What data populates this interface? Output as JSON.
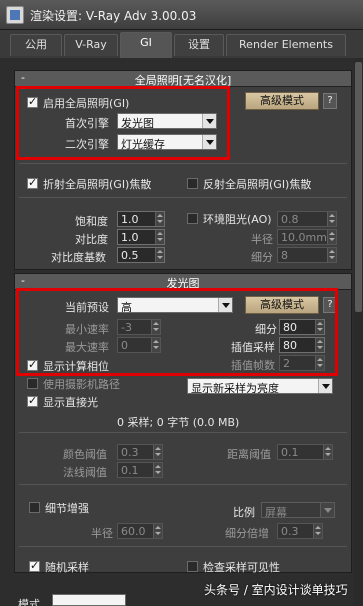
{
  "window": {
    "title": "渲染设置: V-Ray Adv 3.00.03"
  },
  "tabs": [
    {
      "label": "公用"
    },
    {
      "label": "V-Ray"
    },
    {
      "label": "GI"
    },
    {
      "label": "设置"
    },
    {
      "label": "Render Elements"
    }
  ],
  "gi": {
    "rollout_title": "全局照明[无名汉化]",
    "enable_label": "启用全局照明(GI)",
    "advanced_label": "高级模式",
    "help_label": "?",
    "primary_label": "首次引擎",
    "primary_value": "发光图",
    "secondary_label": "二次引擎",
    "secondary_value": "灯光缓存",
    "refractive_label": "折射全局照明(GI)焦散",
    "reflective_label": "反射全局照明(GI)焦散",
    "saturation_label": "饱和度",
    "saturation_value": "1.0",
    "contrast_label": "对比度",
    "contrast_value": "1.0",
    "contrast_base_label": "对比度基数",
    "contrast_base_value": "0.5",
    "ao_label": "环境阻光(AO)",
    "ao_value": "0.8",
    "radius_label": "半径",
    "radius_value": "10.0mm",
    "subdivs_label": "细分",
    "subdivs_value": "8"
  },
  "irradiance": {
    "rollout_title": "发光图",
    "preset_label": "当前预设",
    "preset_value": "高",
    "advanced_label": "高级模式",
    "help_label": "?",
    "min_rate_label": "最小速率",
    "min_rate_value": "-3",
    "max_rate_label": "最大速率",
    "max_rate_value": "0",
    "subdivs_label": "细分",
    "subdivs_value": "80",
    "interp_samples_label": "插值采样",
    "interp_samples_value": "80",
    "interp_frames_label": "插值帧数",
    "interp_frames_value": "2",
    "show_phase_label": "显示计算相位",
    "camera_path_label": "使用摄影机路径",
    "show_mode_value": "显示新采样为亮度",
    "show_direct_label": "显示直接光",
    "samples_info": "0 采样; 0 字节 (0.0 MB)",
    "color_threshold_label": "颜色阈值",
    "color_threshold_value": "0.3",
    "normal_threshold_label": "法线阈值",
    "normal_threshold_value": "0.1",
    "distance_threshold_label": "距离阈值",
    "distance_threshold_value": "0.1",
    "detail_label": "细节增强",
    "scale_label": "比例",
    "scale_value": "屏幕",
    "detail_radius_label": "半径",
    "detail_radius_value": "60.0",
    "subdivs_mult_label": "细分倍增",
    "subdivs_mult_value": "0.3",
    "randomize_label": "随机采样",
    "check_visibility_label": "检查采样可见性",
    "mode_label": "模式"
  },
  "watermark": "头条号 / 室内设计谈单技巧"
}
